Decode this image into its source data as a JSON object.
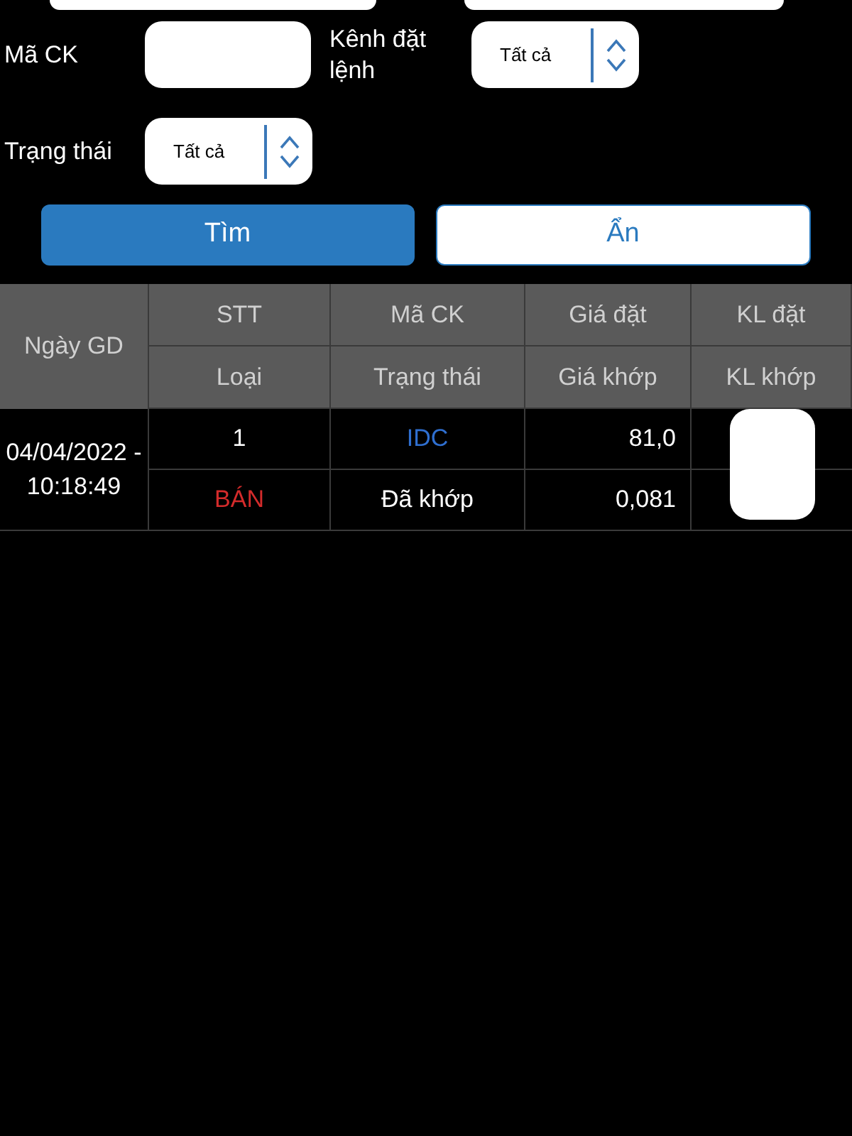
{
  "filters": {
    "stock_code": {
      "label": "Mã CK"
    },
    "channel": {
      "label": "Kênh đặt lệnh",
      "value": "Tất cả"
    },
    "status": {
      "label": "Trạng thái",
      "value": "Tất cả"
    }
  },
  "buttons": [
    {
      "label": "Tìm",
      "kind": "primary"
    },
    {
      "label": "Ẩn",
      "kind": "secondary"
    }
  ],
  "table": {
    "date_header": "Ngày GD",
    "header_rows": [
      [
        "STT",
        "Mã CK",
        "Giá đặt",
        "KL đặt"
      ],
      [
        "Loại",
        "Trạng thái",
        "Giá khớp",
        "KL khớp"
      ]
    ],
    "rows": [
      {
        "date": "04/04/2022 - 10:18:49",
        "line1": [
          {
            "text": "1",
            "color": "#ffffff"
          },
          {
            "text": "IDC",
            "color": "#2f6fd0"
          },
          {
            "text": "81,0",
            "color": "#ffffff"
          }
        ],
        "line2": [
          {
            "text": "BÁN",
            "color": "#d42b2b"
          },
          {
            "text": "Đã khớp",
            "color": "#ffffff"
          },
          {
            "text": "0,081",
            "color": "#ffffff"
          }
        ]
      }
    ]
  }
}
